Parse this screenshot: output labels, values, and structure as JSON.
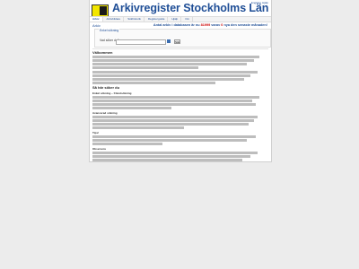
{
  "header": {
    "title": "Arkivregister Stockholms Län",
    "top_link": "English | Hjälp"
  },
  "nav": {
    "tabs": [
      "Arkiv",
      "Arkivbildare",
      "Sökhistorik",
      "Registerguide",
      "Hjälp",
      "Om"
    ]
  },
  "section_link": "Arkiv",
  "count_line": {
    "prefix": "Antal arkiv i databasen är nu",
    "number": "81999",
    "middle": "varav",
    "added": "0",
    "suffix": "nya den senaste månaden!"
  },
  "search": {
    "legend": "Enkel sökning",
    "label": "Vad söker du?",
    "button": "Sök"
  },
  "content": {
    "welcome": "Välkommen",
    "how": "Så här söker du",
    "h_simple": "Enkel sökning – fritextsökning",
    "h_advanced": "Avancerad sökning",
    "h_tips": "Tips!",
    "h_obs": "Observera"
  },
  "colors": {
    "title": "#1f4e96",
    "accent_red": "#cc0000",
    "logo_yellow": "#f2e600"
  }
}
